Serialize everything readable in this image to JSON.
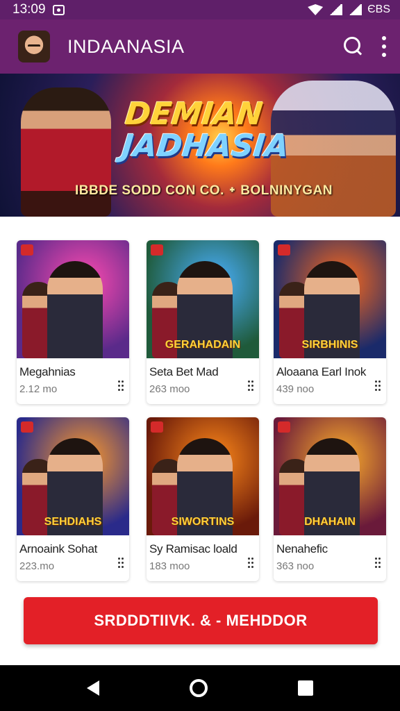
{
  "status_bar": {
    "time": "13:09",
    "right_text": "ЄBS"
  },
  "app_bar": {
    "title": "INDAANASIA"
  },
  "banner": {
    "title_line1": "DEMIAN",
    "title_line2": "JADHASIA",
    "subtitle": "IBBDE SODD CON CO. ᛭ BOLNINYGAN"
  },
  "games": [
    {
      "name": "Megahnias",
      "size": "2.12 mo",
      "logo": "",
      "colors": [
        "#5a2a8a",
        "#ff4ab0"
      ]
    },
    {
      "name": "Seta Bet Mad",
      "size": "263 moo",
      "logo": "GERAHADAIN",
      "colors": [
        "#1f5a3a",
        "#4ab0ff"
      ]
    },
    {
      "name": "Aloaana Earl Inok",
      "size": "439 noo",
      "logo": "SIRBHINIS",
      "colors": [
        "#1a2a6a",
        "#ff6a1a"
      ]
    },
    {
      "name": "Arnoaink Sohat",
      "size": "223.mo",
      "logo": "SEHDIAHS",
      "colors": [
        "#2a2a8a",
        "#ff9a2a"
      ]
    },
    {
      "name": "Sy Ramisac loald",
      "size": "183 moo",
      "logo": "SIWORTINS",
      "colors": [
        "#6a1a0a",
        "#ff8a1a"
      ]
    },
    {
      "name": "Nenahefic",
      "size": "363 noo",
      "logo": "DHAHAIN",
      "colors": [
        "#6a1a3a",
        "#ffb02a"
      ]
    }
  ],
  "cta": {
    "label": "SRDDDTIIVK. & - MEHDDOR"
  },
  "colors": {
    "app_bar": "#6c226f",
    "status_bar": "#5f1f69",
    "cta": "#e32027"
  }
}
